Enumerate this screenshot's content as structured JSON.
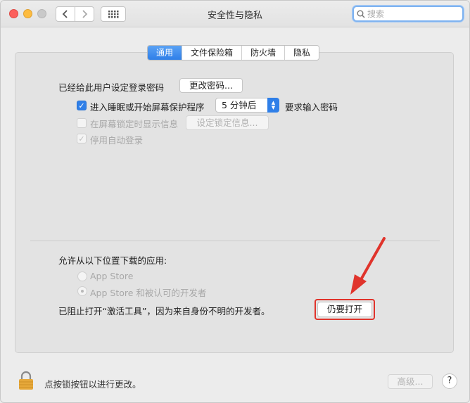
{
  "window": {
    "title": "安全性与隐私"
  },
  "search": {
    "placeholder": "搜索"
  },
  "tabs": [
    {
      "label": "通用",
      "active": true
    },
    {
      "label": "文件保险箱",
      "active": false
    },
    {
      "label": "防火墙",
      "active": false
    },
    {
      "label": "隐私",
      "active": false
    }
  ],
  "general": {
    "password_label": "已经给此用户设定登录密码",
    "change_password_button": "更改密码...",
    "sleep_checkbox_label": "进入睡眠或开始屏幕保护程序",
    "sleep_checked": true,
    "sleep_delay_value": "5 分钟后",
    "require_password_label": "要求输入密码",
    "lock_message_checkbox_label": "在屏幕锁定时显示信息",
    "lock_message_checked": false,
    "set_lock_message_button": "设定锁定信息...",
    "disable_autologin_label": "停用自动登录",
    "disable_autologin_checked": true
  },
  "downloads": {
    "heading": "允许从以下位置下载的应用:",
    "options": [
      {
        "label": "App Store",
        "selected": false
      },
      {
        "label": "App Store 和被认可的开发者",
        "selected": true
      }
    ],
    "blocked_message": "已阻止打开“激活工具”，因为来自身份不明的开发者。",
    "open_anyway_button": "仍要打开"
  },
  "footer": {
    "lock_text": "点按锁按钮以进行更改。",
    "advanced_button": "高级...",
    "help_button": "?"
  },
  "colors": {
    "accent": "#2f7fe8",
    "highlight": "#e0342c"
  }
}
